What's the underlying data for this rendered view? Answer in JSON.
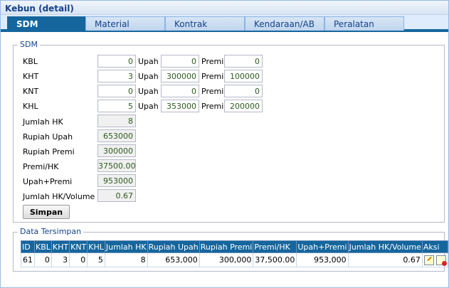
{
  "panel": {
    "title": "Kebun (detail)"
  },
  "tabs": [
    {
      "label": "SDM",
      "active": true
    },
    {
      "label": "Material",
      "active": false
    },
    {
      "label": "Kontrak",
      "active": false
    },
    {
      "label": "Kendaraan/AB",
      "active": false
    },
    {
      "label": "Peralatan",
      "active": false
    }
  ],
  "sdm": {
    "legend": "SDM",
    "upah_label": "Upah",
    "premi_label": "Premi",
    "rows": [
      {
        "label": "KBL",
        "count": "0",
        "upah": "0",
        "premi": "0"
      },
      {
        "label": "KHT",
        "count": "3",
        "upah": "300000",
        "premi": "100000"
      },
      {
        "label": "KNT",
        "count": "0",
        "upah": "0",
        "premi": "0"
      },
      {
        "label": "KHL",
        "count": "5",
        "upah": "353000",
        "premi": "200000"
      }
    ],
    "summary": [
      {
        "label": "Jumlah HK",
        "value": "8"
      },
      {
        "label": "Rupiah Upah",
        "value": "653000"
      },
      {
        "label": "Rupiah Premi",
        "value": "300000"
      },
      {
        "label": "Premi/HK",
        "value": "37500.00"
      },
      {
        "label": "Upah+Premi",
        "value": "953000"
      },
      {
        "label": "Jumlah HK/Volume",
        "value": "0.67"
      }
    ],
    "save_label": "Simpan"
  },
  "saved": {
    "legend": "Data Tersimpan",
    "columns": [
      "ID",
      "KBL",
      "KHT",
      "KNT",
      "KHL",
      "Jumlah HK",
      "Rupiah Upah",
      "Rupiah Premi",
      "Premi/HK",
      "Upah+Premi",
      "Jumlah HK/Volume",
      "Aksi"
    ],
    "rows": [
      [
        "61",
        "0",
        "3",
        "0",
        "5",
        "8",
        "653,000",
        "300,000",
        "37,500.00",
        "953,000",
        "0.67"
      ]
    ],
    "actions": [
      "edit-icon",
      "delete-icon"
    ]
  }
}
